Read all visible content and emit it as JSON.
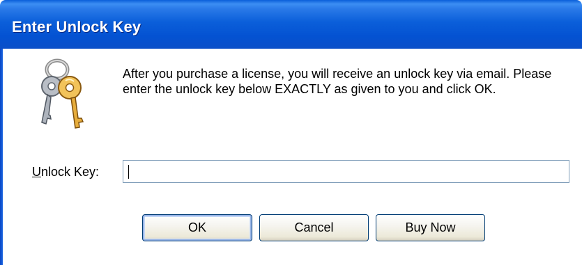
{
  "window": {
    "title": "Enter Unlock Key"
  },
  "dialog": {
    "icon": "keys-icon",
    "message": "After you purchase a license, you will receive an unlock key via email. Please enter the unlock key below EXACTLY as given to you and click OK.",
    "unlock_key_label_accel": "U",
    "unlock_key_label_rest": "nlock Key:",
    "unlock_key_value": "",
    "unlock_key_placeholder": ""
  },
  "buttons": {
    "ok_label": "OK",
    "cancel_label": "Cancel",
    "buy_now_label": "Buy Now"
  },
  "colors": {
    "titlebar": "#0a5fd9",
    "frame": "#0845c4",
    "button_face": "#ece9d8",
    "button_border": "#003c74",
    "default_button_focus": "#98b4e6"
  }
}
